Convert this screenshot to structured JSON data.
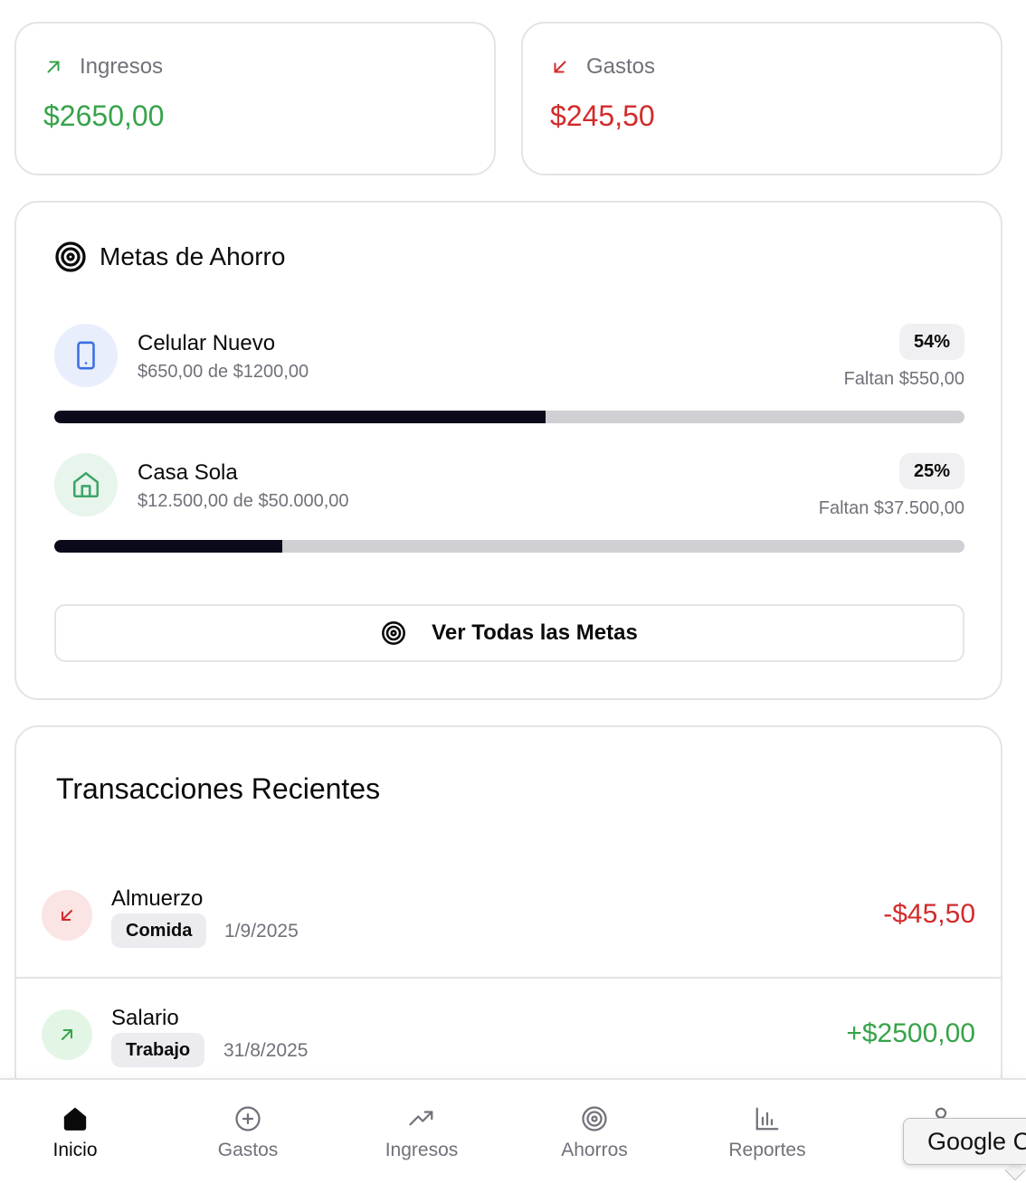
{
  "summary": {
    "income": {
      "label": "Ingresos",
      "amount": "$2650,00",
      "color": "#37a34a"
    },
    "expenses": {
      "label": "Gastos",
      "amount": "$245,50",
      "color": "#d22b2b"
    }
  },
  "goals": {
    "title": "Metas de Ahorro",
    "items": [
      {
        "name": "Celular Nuevo",
        "progress_text": "$650,00 de $1200,00",
        "percent": "54%",
        "remaining": "Faltan $550,00",
        "progress": 0.54,
        "icon": "smartphone-icon",
        "icon_color": "#3b6fe0",
        "icon_bg": "#e8eefc"
      },
      {
        "name": "Casa Sola",
        "progress_text": "$12.500,00 de $50.000,00",
        "percent": "25%",
        "remaining": "Faltan $37.500,00",
        "progress": 0.25,
        "icon": "home-icon",
        "icon_color": "#3fa56a",
        "icon_bg": "#e7f5ec"
      }
    ],
    "view_all_label": "Ver Todas las Metas"
  },
  "transactions": {
    "title": "Transacciones Recientes",
    "items": [
      {
        "name": "Almuerzo",
        "category": "Comida",
        "date": "1/9/2025",
        "amount": "-$45,50",
        "type": "expense",
        "color": "#d22b2b",
        "icon_bg": "#fbe4e4"
      },
      {
        "name": "Salario",
        "category": "Trabajo",
        "date": "31/8/2025",
        "amount": "+$2500,00",
        "type": "income",
        "color": "#37a34a",
        "icon_bg": "#e3f6e6"
      }
    ]
  },
  "nav": {
    "items": [
      {
        "label": "Inicio",
        "icon": "home-filled-icon",
        "active": true
      },
      {
        "label": "Gastos",
        "icon": "plus-circle-icon",
        "active": false
      },
      {
        "label": "Ingresos",
        "icon": "trending-up-icon",
        "active": false
      },
      {
        "label": "Ahorros",
        "icon": "target-icon",
        "active": false
      },
      {
        "label": "Reportes",
        "icon": "bar-chart-icon",
        "active": false
      },
      {
        "label": "",
        "icon": "user-icon",
        "active": false
      }
    ]
  },
  "tooltip": {
    "text": "Google C"
  }
}
